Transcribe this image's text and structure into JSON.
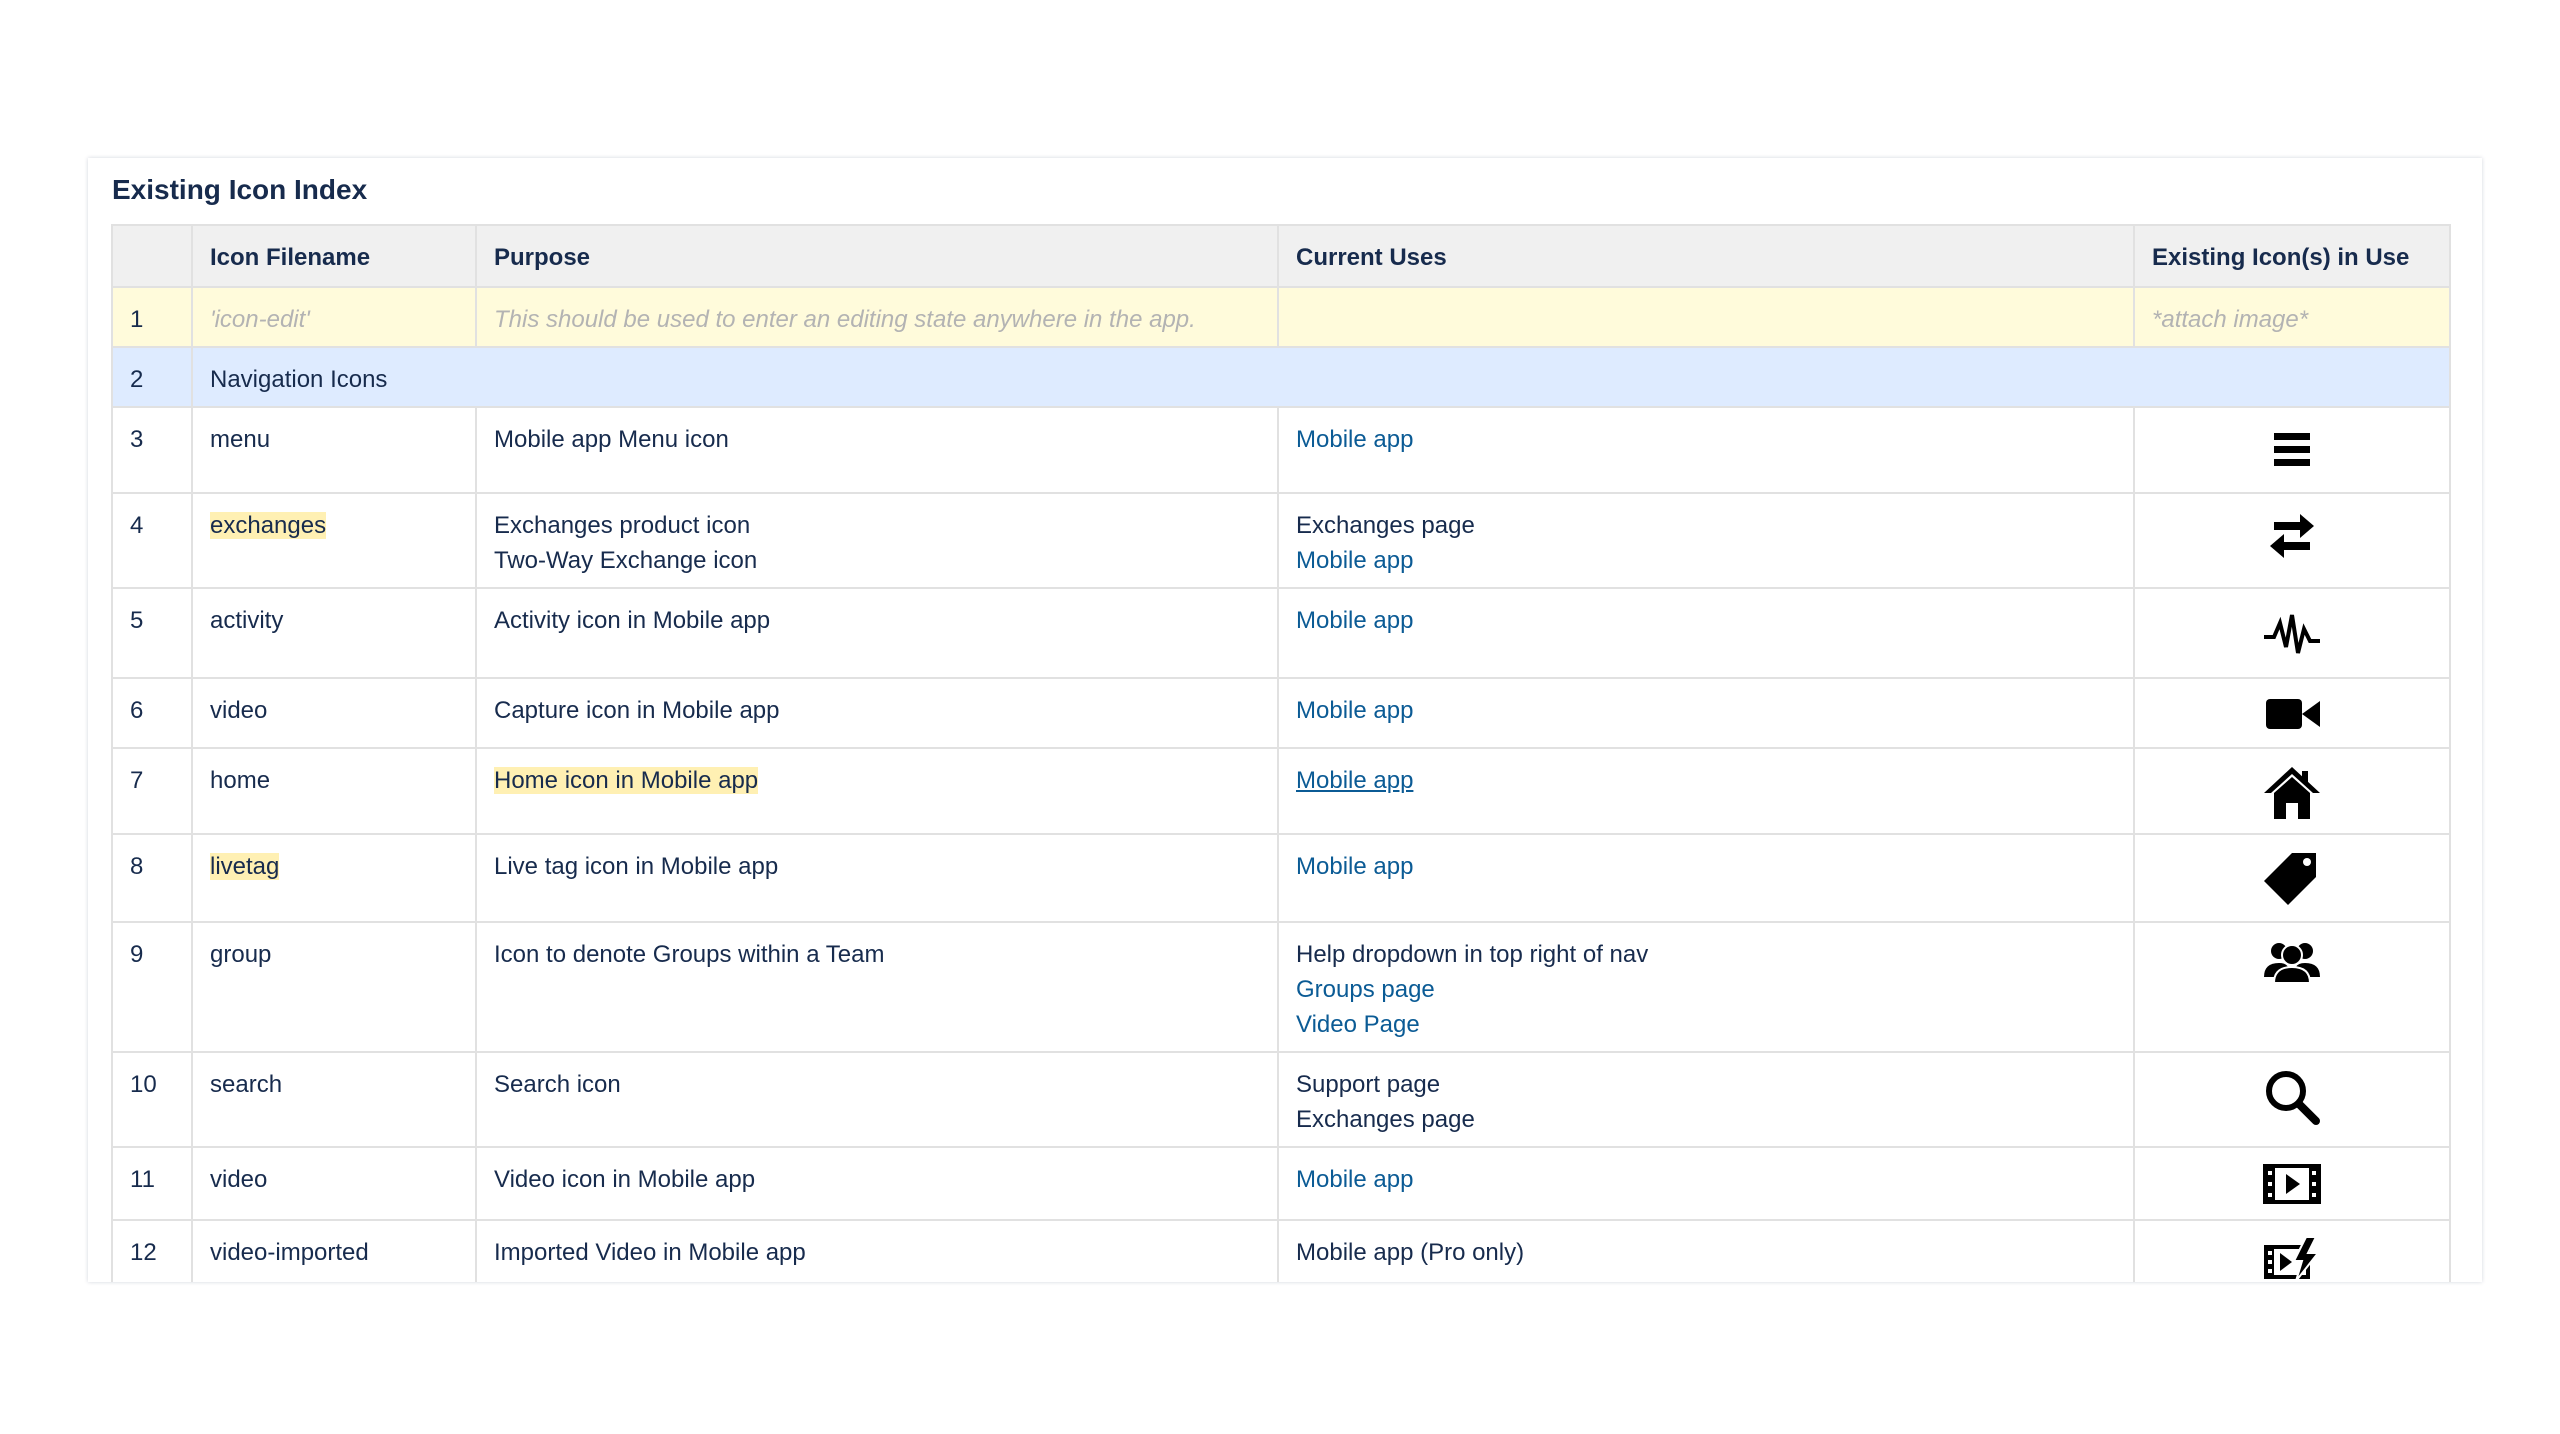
{
  "panel": {
    "title": "Existing Icon Index"
  },
  "table": {
    "headers": [
      "",
      "Icon Filename",
      "Purpose",
      "Current Uses",
      "Existing Icon(s) in Use"
    ],
    "rows": [
      {
        "num": "1",
        "filename": "'icon-edit'",
        "purpose": [
          "This should be used to enter an editing state anywhere in the app."
        ],
        "uses": [],
        "icon_text": "*attach image*"
      },
      {
        "num": "2",
        "section": "Navigation Icons"
      },
      {
        "num": "3",
        "filename": "menu",
        "purpose": [
          "Mobile app Menu icon"
        ],
        "uses": [
          {
            "text": "Mobile app",
            "link": true
          }
        ],
        "icon": "menu-icon"
      },
      {
        "num": "4",
        "filename": "exchanges",
        "purpose": [
          "Exchanges product icon",
          "Two-Way Exchange icon"
        ],
        "uses": [
          {
            "text": "Exchanges page",
            "link": false
          },
          {
            "text": "Mobile app",
            "link": true
          }
        ],
        "icon": "exchange-arrows-icon"
      },
      {
        "num": "5",
        "filename": "activity",
        "purpose": [
          "Activity icon in Mobile app"
        ],
        "uses": [
          {
            "text": "Mobile app",
            "link": true
          }
        ],
        "icon": "activity-pulse-icon"
      },
      {
        "num": "6",
        "filename": "video",
        "purpose": [
          "Capture icon in Mobile app"
        ],
        "uses": [
          {
            "text": "Mobile app",
            "link": true
          }
        ],
        "icon": "video-camera-icon"
      },
      {
        "num": "7",
        "filename": "home",
        "purpose": [
          "Home icon in Mobile app"
        ],
        "uses": [
          {
            "text": "Mobile app",
            "link": true
          }
        ],
        "icon": "home-icon"
      },
      {
        "num": "8",
        "filename": "livetag",
        "purpose": [
          "Live tag icon in Mobile app"
        ],
        "uses": [
          {
            "text": "Mobile app",
            "link": true
          }
        ],
        "icon": "tag-icon"
      },
      {
        "num": "9",
        "filename": "group",
        "purpose": [
          "Icon to denote Groups within a Team"
        ],
        "uses": [
          {
            "text": "Help dropdown in top right of nav",
            "link": false
          },
          {
            "text": "Groups page",
            "link": true
          },
          {
            "text": "Video Page",
            "link": true
          }
        ],
        "icon": "group-icon"
      },
      {
        "num": "10",
        "filename": "search",
        "purpose": [
          "Search icon"
        ],
        "uses": [
          {
            "text": "Support page",
            "link": false
          },
          {
            "text": "Exchanges page",
            "link": false
          }
        ],
        "icon": "search-icon"
      },
      {
        "num": "11",
        "filename": "video",
        "purpose": [
          "Video icon in Mobile app"
        ],
        "uses": [
          {
            "text": "Mobile app",
            "link": true
          }
        ],
        "icon": "film-icon"
      },
      {
        "num": "12",
        "filename": "video-imported",
        "purpose": [
          "Imported Video in Mobile app"
        ],
        "uses": [
          {
            "text": "Mobile app (Pro only)",
            "link": false
          }
        ],
        "icon": "video-imported-icon"
      }
    ]
  },
  "colors": {
    "header_bg": "#f0f0f0",
    "row_yellow_bg": "#fffbdb",
    "row_blue_bg": "#deebff",
    "highlight_bg": "#fff0b3",
    "link": "#0b5b95",
    "text": "#172b4d"
  }
}
